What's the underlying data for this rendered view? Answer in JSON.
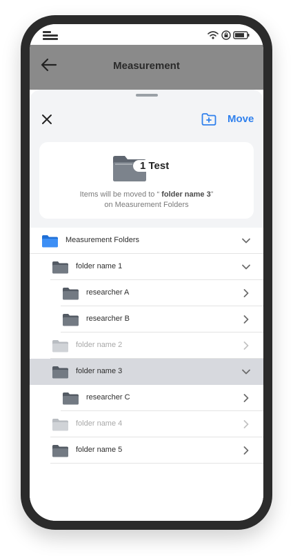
{
  "header": {
    "title": "Measurement"
  },
  "sheet": {
    "move_label": "Move",
    "summary": {
      "count": "1 Test",
      "message_prefix": "Items will be moved to “ ",
      "destination": "folder name 3",
      "message_suffix": "”",
      "message_line2": "on Measurement Folders"
    }
  },
  "tree": [
    {
      "label": "Measurement Folders",
      "level": 0,
      "state": "normal",
      "chevron": "down",
      "icon": "folder-blue-icon"
    },
    {
      "label": "folder name 1",
      "level": 1,
      "state": "normal",
      "chevron": "down",
      "icon": "folder-icon"
    },
    {
      "label": "researcher A",
      "level": 2,
      "state": "normal",
      "chevron": "right",
      "icon": "folder-icon"
    },
    {
      "label": "researcher B",
      "level": 2,
      "state": "normal",
      "chevron": "right",
      "icon": "folder-icon"
    },
    {
      "label": "folder name 2",
      "level": 1,
      "state": "disabled",
      "chevron": "right",
      "icon": "folder-icon"
    },
    {
      "label": "folder name 3",
      "level": 1,
      "state": "selected",
      "chevron": "down",
      "icon": "folder-icon"
    },
    {
      "label": "researcher C",
      "level": 2,
      "state": "normal",
      "chevron": "right",
      "icon": "folder-icon"
    },
    {
      "label": "folder name 4",
      "level": 1,
      "state": "disabled",
      "chevron": "right",
      "icon": "folder-icon"
    },
    {
      "label": "folder name 5",
      "level": 1,
      "state": "normal",
      "chevron": "right",
      "icon": "folder-icon"
    }
  ],
  "colors": {
    "accent": "#2f80ed",
    "selected_row": "#d7d9de",
    "folder": "#5f6670",
    "folder_disabled": "#c4c7cc",
    "folder_root": "#2f80ed"
  }
}
